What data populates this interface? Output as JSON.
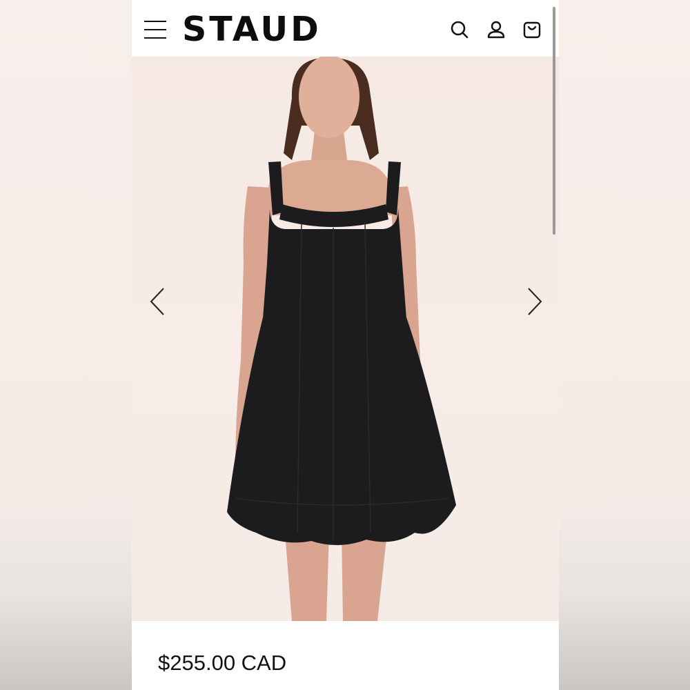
{
  "header": {
    "brand": "STAUD",
    "icons": [
      "menu-icon",
      "search-icon",
      "account-icon",
      "bag-icon"
    ]
  },
  "product": {
    "price": "$255.00 CAD",
    "image": {
      "subject": "black-mini-dress",
      "prev_icon": "chevron-left-icon",
      "next_icon": "chevron-right-icon"
    }
  },
  "colors": {
    "brand_text": "#0d0d0d",
    "hero_background": "#f6e9e3",
    "dress": "#1c1c1e"
  }
}
